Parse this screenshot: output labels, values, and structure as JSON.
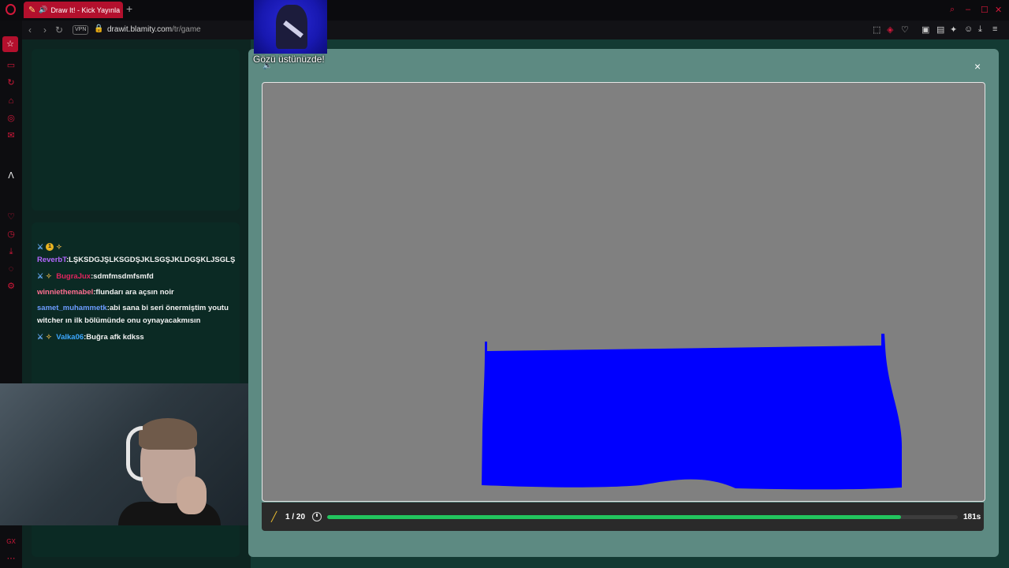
{
  "browser": {
    "tab_title": "Draw It! - Kick Yayınla",
    "url_host": "drawit.blamity.com",
    "url_path": "/tr/game",
    "vpn_label": "VPN",
    "accent_color": "#d3183a"
  },
  "alert": {
    "text": "Gözü üstünüzde!"
  },
  "chat": {
    "messages": [
      {
        "user": "ReverbT",
        "text": ":LŞKSDGJŞLKSGDŞJKLSGŞJKLDGŞKLJSGLŞ",
        "user_color": "#b367ff",
        "badges": "sword,1,sub"
      },
      {
        "user": "BugraJux",
        "text": ":sdmfmsdmfsmfd",
        "user_color": "#e0245e",
        "badges": "sword,sub"
      },
      {
        "user": "winniethemabel",
        "text": ":flundarı ara açsın noir",
        "user_color": "#ff6f91",
        "badges": ""
      },
      {
        "user": "samet_muhammetk",
        "text": ":abi sana bi seri önermiştim youtu witcher ın ilk bölümünde onu oynayacakmısın",
        "user_color": "#6c9cff",
        "badges": ""
      },
      {
        "user": "Valka06",
        "text": ":Buğra afk kdkss",
        "user_color": "#3da8ff",
        "badges": "sword,sub"
      }
    ]
  },
  "game": {
    "round_label": "1 / 20",
    "time_label": "181s",
    "progress_percent": 91,
    "drawing_color": "#0000ff",
    "canvas_bg": "#808080"
  },
  "icons": {
    "sidebar": [
      "star-icon",
      "wallet-icon",
      "refresh-icon",
      "shop-icon",
      "instagram-icon",
      "mail-icon",
      "kick-icon",
      "heart-icon",
      "history-icon",
      "download-icon",
      "chat-icon",
      "settings-icon",
      "gx-icon",
      "more-icon"
    ]
  }
}
